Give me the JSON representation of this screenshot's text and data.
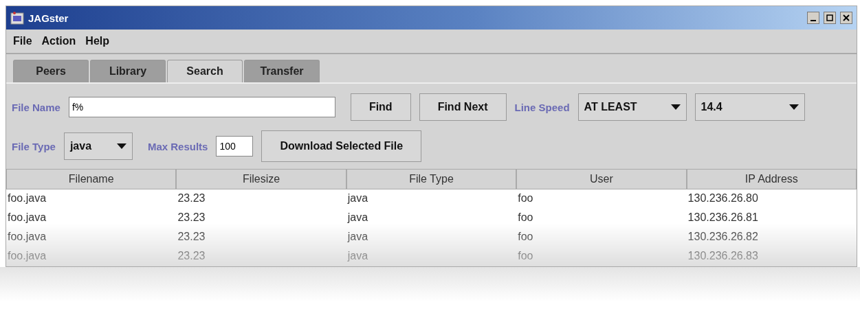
{
  "window": {
    "title": "JAGster"
  },
  "menu": [
    "File",
    "Action",
    "Help"
  ],
  "tabs": [
    {
      "label": "Peers",
      "selected": false
    },
    {
      "label": "Library",
      "selected": false
    },
    {
      "label": "Search",
      "selected": true
    },
    {
      "label": "Transfer",
      "selected": false
    }
  ],
  "search": {
    "file_name_label": "File Name",
    "file_name": "f%",
    "find_button": "Find",
    "find_next_button": "Find Next",
    "line_speed_label": "Line Speed",
    "line_speed_mode": "AT LEAST",
    "line_speed": "14.4",
    "file_type_label": "File Type",
    "file_type": "java",
    "max_results_label": "Max Results",
    "max_results": "100",
    "download_button": "Download Selected File"
  },
  "table": {
    "columns": [
      "Filename",
      "Filesize",
      "File Type",
      "User",
      "IP Address"
    ],
    "rows": [
      [
        "foo.java",
        "23.23",
        "java",
        "foo",
        "130.236.26.80"
      ],
      [
        "foo.java",
        "23.23",
        "java",
        "foo",
        "130.236.26.81"
      ],
      [
        "foo.java",
        "23.23",
        "java",
        "foo",
        "130.236.26.82"
      ],
      [
        "foo.java",
        "23.23",
        "java",
        "foo",
        "130.236.26.83"
      ]
    ]
  }
}
